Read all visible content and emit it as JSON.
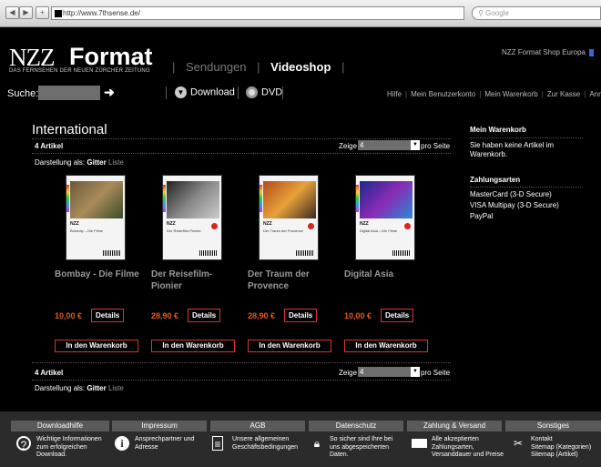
{
  "browser": {
    "url": "http://www.7thsense.de/",
    "search_placeholder": "Google",
    "back_icon": "back-arrow-icon",
    "forward_icon": "forward-arrow-icon",
    "add_icon": "plus-icon"
  },
  "header": {
    "logo_nzz": "NZZ",
    "logo_format": "Format",
    "logo_tagline": "DAS FERNSEHEN DER NEUEN ZÜRCHER ZEITUNG",
    "nav": [
      "Sendungen",
      "Videoshop"
    ],
    "shop_region": "NZZ Format Shop Europa"
  },
  "toolbar": {
    "search_label": "Suche:",
    "search_value": "",
    "download_label": "Download",
    "dvd_label": "DVD",
    "links": [
      "Hilfe",
      "Mein Benutzerkonto",
      "Mein Warenkorb",
      "Zur Kasse",
      "Anmelden"
    ]
  },
  "main": {
    "category_title": "International",
    "count_label": "4 Artikel",
    "zeige_label": "Zeige",
    "zeige_value": "4",
    "per_page_label": "pro Seite",
    "display_label": "Darstellung als:",
    "display_grid": "Gitter",
    "display_list": "Liste",
    "details_label": "Details",
    "cart_label": "In den Warenkorb",
    "products": [
      {
        "title": "Bombay - Die Filme",
        "price": "10,00 €",
        "cover_title": "Bombay – Die Filme",
        "photo": [
          "#6a5a3c",
          "#a98b59",
          "#3a4a2c"
        ]
      },
      {
        "title": "Der Reisefilm-Pionier",
        "price": "28,90 €",
        "cover_title": "Der Reisefilm-Pionier",
        "photo": [
          "#222",
          "#888",
          "#ccc"
        ]
      },
      {
        "title": "Der Traum der Provence",
        "price": "28,90 €",
        "cover_title": "Der Traum der Provence",
        "photo": [
          "#b54a1a",
          "#e6a23a",
          "#3b2a20"
        ]
      },
      {
        "title": "Digital Asia",
        "price": "10,00 €",
        "cover_title": "Digital Asia – Die Filme",
        "photo": [
          "#1a2a8a",
          "#8a2ab4",
          "#2a8ad4"
        ]
      }
    ]
  },
  "sidebar": {
    "cart_heading": "Mein Warenkorb",
    "cart_text": "Sie haben keine Artikel im Warenkorb.",
    "payment_heading": "Zahlungsarten",
    "payment_methods": [
      "MasterCard (3-D Secure)",
      "VISA Multipay (3-D Secure)",
      "PayPal"
    ]
  },
  "footer": {
    "tabs": [
      "Downloadhilfe",
      "Impressum",
      "AGB",
      "Datenschutz",
      "Zahlung & Versand",
      "Sonstiges"
    ],
    "items": [
      {
        "icon": "help-icon",
        "text": "Wichtige Informationen zum erfolgreichen Download."
      },
      {
        "icon": "info-icon",
        "text": "Ansprechpartner und Adresse"
      },
      {
        "icon": "document-icon",
        "text": "Unsere allgemeinen Geschäftsbedingungen"
      },
      {
        "icon": "lock-icon",
        "text": "So sicher sind Ihre bei uns abgespeicherten Daten."
      },
      {
        "icon": "creditcard-icon",
        "text": "Alle akzeptierten Zahlungsarten, Versanddauer und Preise"
      },
      {
        "icon": "tools-icon",
        "text": "Kontakt\nSitemap (Kategorien)\nSitemap (Artikel)"
      }
    ]
  }
}
